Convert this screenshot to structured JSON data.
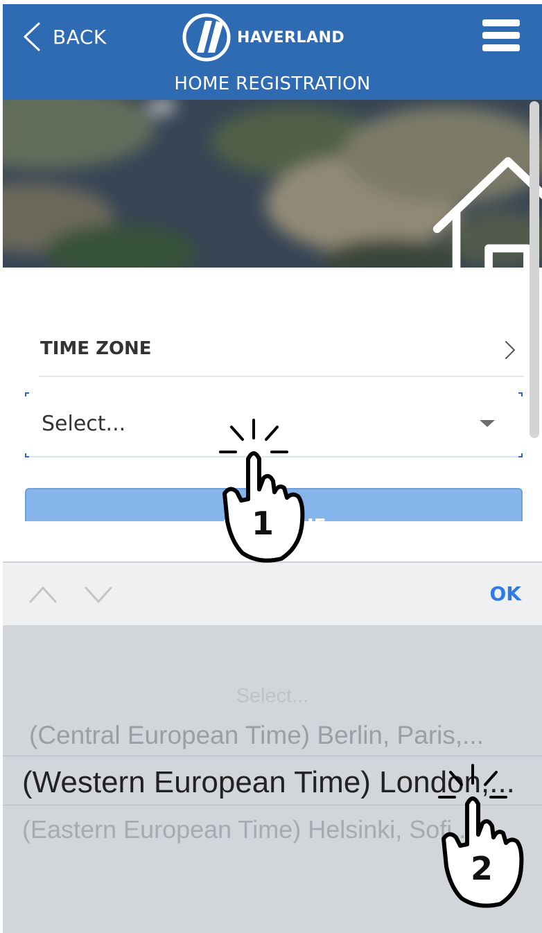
{
  "header": {
    "back_label": "BACK",
    "brand": "HAVERLAND",
    "subtitle": "HOME REGISTRATION",
    "background_color": "#2f6bb3"
  },
  "icons": {
    "back": "chevron-left-icon",
    "logo": "haverland-logo",
    "menu": "hamburger-menu-icon",
    "home": "home-icon",
    "time_zone_chevron": "chevron-right-icon",
    "select_caret": "caret-down-icon",
    "picker_prev": "chevron-up-icon",
    "picker_next": "chevron-down-icon",
    "tap_hand": "tap-hand-icon"
  },
  "form": {
    "time_zone_label": "TIME ZONE",
    "select_value": "Select...",
    "continue_label": "CONTINUE"
  },
  "picker": {
    "done_label": "OK",
    "options": [
      "Select...",
      "(Central European Time) Berlin, Paris,...",
      "(Western European Time) London,...",
      "(Eastern European Time) Helsinki, Sofi..."
    ],
    "selected": "(Western European Time) London,..."
  },
  "annotations": {
    "step_1": "1",
    "step_2": "2"
  },
  "colors": {
    "accent": "#2f6bb3",
    "button": "#86b5ec",
    "ok": "#2f7ae5",
    "picker_bg": "#d2d5da"
  }
}
